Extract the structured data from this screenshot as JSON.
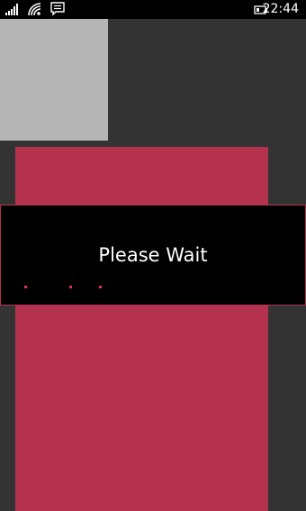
{
  "status_bar": {
    "time": "22:44",
    "icons": [
      "signal-strength-icon",
      "wifi-icon",
      "notification-message-icon",
      "battery-icon"
    ]
  },
  "dialog": {
    "title": "Please Wait",
    "indicator": "progress-dots"
  },
  "colors": {
    "background": "#333333",
    "status_bar": "#000000",
    "gray_tile": "#b5b5b5",
    "accent": "#b5324f",
    "dialog_background": "#000000",
    "progress_dot": "#e0305a",
    "text": "#ffffff"
  }
}
